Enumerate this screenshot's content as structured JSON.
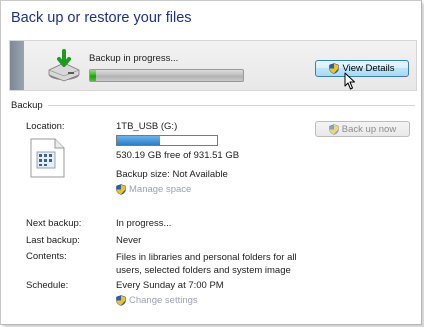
{
  "page": {
    "title": "Back up or restore your files"
  },
  "progress": {
    "label": "Backup in progress...",
    "fraction": 0.04,
    "view_details_label": "View Details"
  },
  "backup_section": {
    "header": "Backup",
    "location_label": "Location:",
    "drive_name": "1TB_USB (G:)",
    "drive_used_fraction": 0.43,
    "free_space": "530.19 GB free of 931.51 GB",
    "backup_size": "Backup size: Not Available",
    "manage_space_label": "Manage space",
    "backup_now_label": "Back up now",
    "next_backup_label": "Next backup:",
    "next_backup_value": "In progress...",
    "last_backup_label": "Last backup:",
    "last_backup_value": "Never",
    "contents_label": "Contents:",
    "contents_value": "Files in libraries and personal folders for all users, selected folders and system image",
    "schedule_label": "Schedule:",
    "schedule_value": "Every Sunday at 7:00 PM",
    "change_settings_label": "Change settings"
  },
  "icons": {
    "backup": "backup-drive-icon",
    "drive": "document-drive-icon",
    "shield": "uac-shield-icon",
    "cursor": "mouse-cursor-icon"
  },
  "colors": {
    "title": "#1e3287",
    "progress_fill": "#31b41a",
    "drive_fill": "#2a7ec8",
    "link_disabled": "#98a3b4"
  }
}
